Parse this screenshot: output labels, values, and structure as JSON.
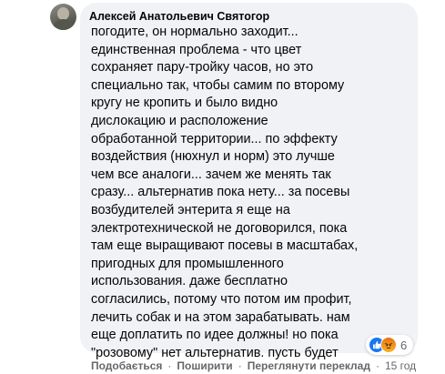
{
  "comment": {
    "author": "Алексей Анатольевич Святогор",
    "lines": [
      "погодите, он нормально заходит...",
      "единственная проблема - что цвет",
      "сохраняет пару-тройку часов, но это",
      "специально так, чтобы самим по второму",
      "кругу не кропить и было видно",
      "дислокацию и расположение",
      "обработанной территории... по эффекту",
      "воздействия (нюхнул и норм) это лучше",
      "чем все аналоги... зачем же менять так",
      "сразу... альтернатив пока нету... за посевы",
      "возбудителей энтерита я еще на",
      "электротехнической не договорился, пока",
      "там еще выращивают посевы в масштабах,",
      "пригодных для промышленного",
      "использования. даже бесплатно",
      "согласились, потому что потом им профит,",
      "лечить собак и на этом зарабатывать. нам",
      "еще доплатить по идее должны! но пока",
      "\"розовому\" нет альтернатив. пусть будет"
    ],
    "reactions": {
      "icons": [
        "like-icon",
        "angry-icon"
      ],
      "count": "6",
      "colors": {
        "like": "#1877f2",
        "angry": "#f7b125"
      }
    },
    "actions": {
      "like_label": "Подобається",
      "reply_label": "Поширити",
      "translate_label": "Переглянути переклад",
      "separator": "·",
      "time": "15 год"
    }
  }
}
